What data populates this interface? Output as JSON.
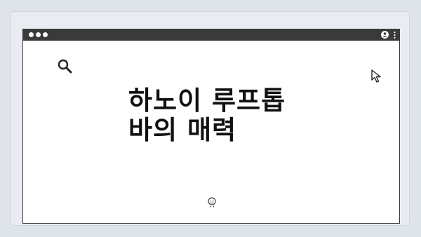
{
  "article": {
    "title_line1": "하노이 루프톱",
    "title_line2": "바의 매력"
  },
  "icons": {
    "search": "search-icon",
    "cursor": "cursor-icon",
    "profile": "profile-icon",
    "menu": "kebab-menu-icon",
    "face": "face-icon"
  },
  "colors": {
    "background": "#dfe4ea",
    "title_bar": "#3a3a3a",
    "window": "#ffffff",
    "text": "#111111"
  }
}
